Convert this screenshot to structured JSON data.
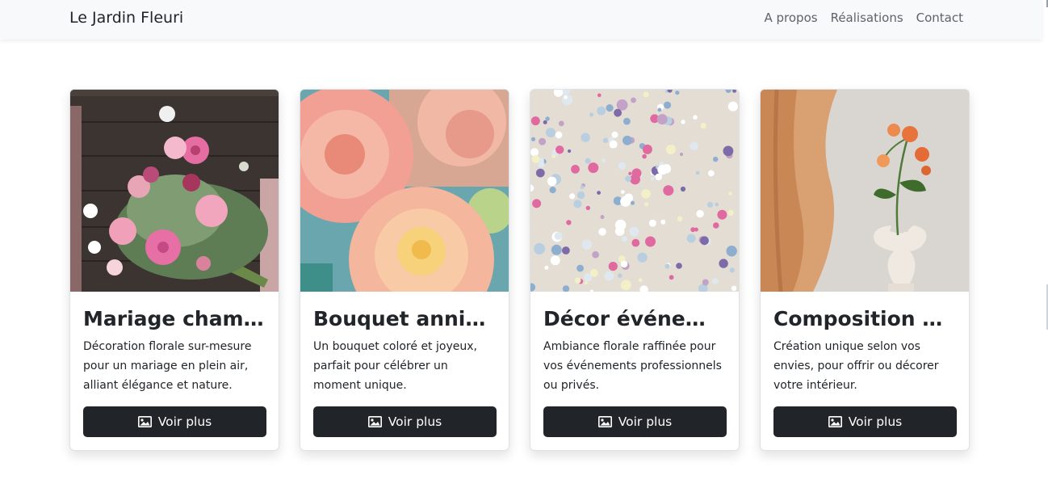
{
  "navbar": {
    "brand": "Le Jardin Fleuri",
    "links": [
      "A propos",
      "Réalisations",
      "Contact"
    ]
  },
  "cards": [
    {
      "title": "Mariage champêtre",
      "text": "Décoration florale sur-mesure pour un mariage en plein air, alliant élégance et nature.",
      "button": "Voir plus",
      "image_icon": "image-icon"
    },
    {
      "title": "Bouquet anniversaire",
      "text": "Un bouquet coloré et joyeux, parfait pour célébrer un moment unique.",
      "button": "Voir plus",
      "image_icon": "image-icon"
    },
    {
      "title": "Décor événementiel",
      "text": "Ambiance florale raffinée pour vos événements professionnels ou privés.",
      "button": "Voir plus",
      "image_icon": "image-icon"
    },
    {
      "title": "Composition personnalisée",
      "text": "Création unique selon vos envies, pour offrir ou décorer votre intérieur.",
      "button": "Voir plus",
      "image_icon": "image-icon"
    }
  ],
  "colors": {
    "navbar_bg": "#f8f9fa",
    "button_bg": "#212529",
    "text": "#212529",
    "nav_link": "#5c636a"
  }
}
